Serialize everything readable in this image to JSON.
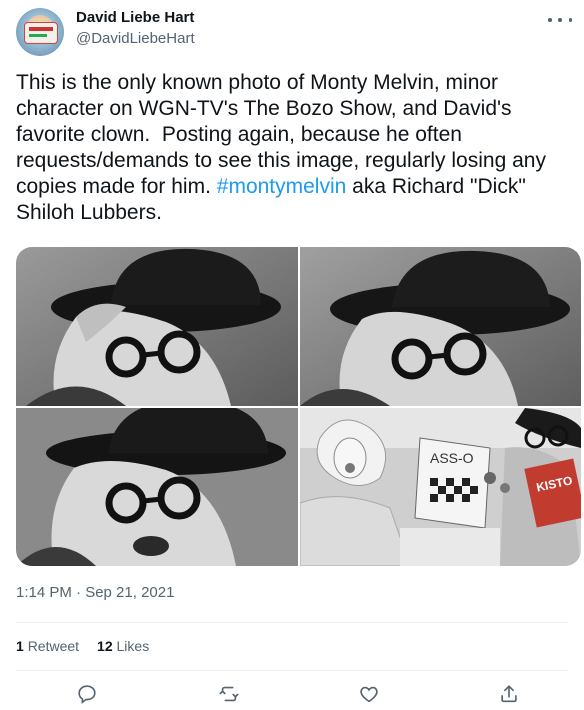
{
  "user": {
    "display_name": "David Liebe Hart",
    "handle": "@DavidLiebeHart"
  },
  "tweet": {
    "text_before": "This is the only known photo of Monty Melvin, minor character on WGN-TV's The Bozo Show, and David's favorite clown.  Posting again, because he often requests/demands to see this image, regularly losing any copies made for him. ",
    "hashtag": "#montymelvin",
    "text_after": " aka Richard \"Dick\" Shiloh Lubbers.",
    "timestamp": "1:14 PM · Sep 21, 2021"
  },
  "stats": {
    "retweets_count": "1",
    "retweets_label": "Retweet",
    "likes_count": "12",
    "likes_label": "Likes"
  },
  "media": {
    "photo4_sign_text": "ASS-O",
    "photo4_card_text": "KISTO"
  },
  "icons": {
    "more": "more-horizontal-icon",
    "reply": "reply-icon",
    "retweet": "retweet-icon",
    "like": "like-icon",
    "share": "share-icon"
  },
  "colors": {
    "link": "#1d9bf0",
    "secondary_text": "#536471",
    "primary_text": "#0f1419"
  }
}
